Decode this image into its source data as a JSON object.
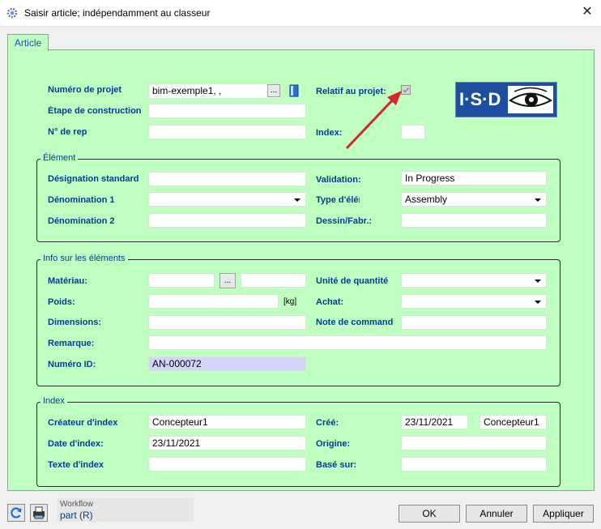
{
  "window": {
    "title": "Saisir article; indépendamment au classeur",
    "close_label": "✕"
  },
  "tab": {
    "label": "Article"
  },
  "top": {
    "numero_projet_label": "Numéro de projet",
    "numero_projet_value": "bim-exemple1, ,",
    "browse_label": "...",
    "etape_label": "Étape de construction",
    "nrep_label": "N° de rep",
    "relatif_label": "Relatif au projet:",
    "relatif_checked": true,
    "index_label": "Index:",
    "logo_text": "I·S·D"
  },
  "element": {
    "legend": "Élément",
    "designation_label": "Désignation standard",
    "denom1_label": "Dénomination 1",
    "denom2_label": "Dénomination 2",
    "validation_label": "Validation:",
    "validation_value": "In Progress",
    "type_label": "Type d'élément",
    "type_value": "Assembly",
    "dessin_label": "Dessin/Fabr.:"
  },
  "info": {
    "legend": "Info sur les éléments",
    "materiau_label": "Matériau:",
    "materiau_btn": "...",
    "poids_label": "Poids:",
    "kg_label": "[kg]",
    "dimensions_label": "Dimensions:",
    "remarque_label": "Remarque:",
    "numero_id_label": "Numéro ID:",
    "numero_id_value": "AN-000072",
    "unite_label": "Unité de quantité",
    "achat_label": "Achat:",
    "note_label": "Note de commande"
  },
  "index": {
    "legend": "Index",
    "createur_label": "Créateur d'index",
    "createur_value": "Concepteur1",
    "date_label": "Date d'index:",
    "date_value": "23/11/2021",
    "texte_label": "Texte d'index",
    "cree_label": "Créé:",
    "cree_date": "23/11/2021",
    "cree_user": "Concepteur1",
    "origine_label": "Origine:",
    "base_label": "Basé sur:"
  },
  "footer": {
    "workflow_caption": "Workflow",
    "workflow_value": "part (R)",
    "ok_label": "OK",
    "cancel_label": "Annuler",
    "apply_label": "Appliquer"
  },
  "colors": {
    "panel": "#bfffbf",
    "label": "#003c9b",
    "id_field": "#d4d4f8"
  }
}
